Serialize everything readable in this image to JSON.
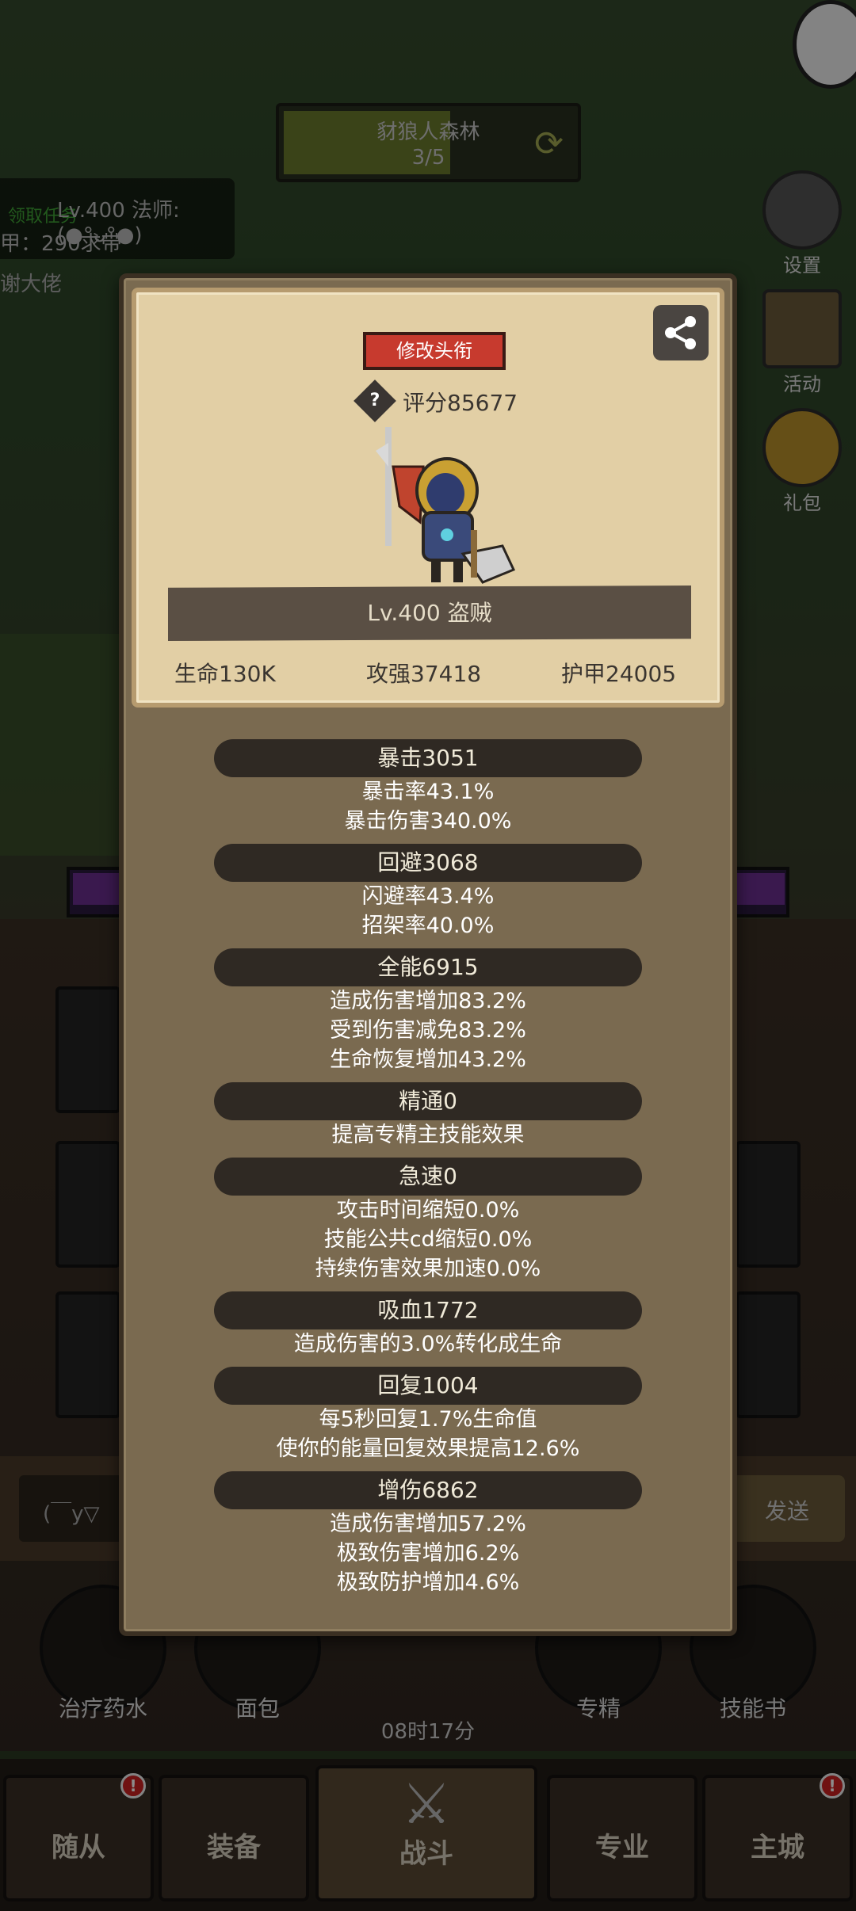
{
  "stage": {
    "title": "豺狼人森林",
    "count": "3/5"
  },
  "player": {
    "quest": "领取任务",
    "level_line": "Lv.400 法师: (●°ᴗ°●)",
    "armor_line": "甲：290求带",
    "thanks": "谢大佬"
  },
  "side_buttons": [
    {
      "label": "设置"
    },
    {
      "label": "活动"
    },
    {
      "label": "礼包"
    }
  ],
  "chat": {
    "placeholder": "(￣y▽",
    "send": "发送"
  },
  "items": [
    {
      "label": "治疗药水"
    },
    {
      "label": "面包"
    },
    {
      "label": "专精"
    },
    {
      "label": "技能书"
    }
  ],
  "timer": "08时17分",
  "nav": {
    "tabs": [
      {
        "label": "随从",
        "badge": "!"
      },
      {
        "label": "装备",
        "badge": ""
      },
      {
        "label": "战斗",
        "badge": ""
      },
      {
        "label": "专业",
        "badge": ""
      },
      {
        "label": "主城",
        "badge": "!"
      }
    ]
  },
  "modal": {
    "edit_title_button": "修改头衔",
    "help": "?",
    "score": "评分85677",
    "class_line": "Lv.400 盗贼",
    "core": {
      "hp": "生命130K",
      "attack": "攻强37418",
      "armor": "护甲24005"
    },
    "stats": [
      {
        "header": "暴击3051",
        "lines": [
          "暴击率43.1%",
          "暴击伤害340.0%"
        ]
      },
      {
        "header": "回避3068",
        "lines": [
          "闪避率43.4%",
          "招架率40.0%"
        ]
      },
      {
        "header": "全能6915",
        "lines": [
          "造成伤害增加83.2%",
          "受到伤害减免83.2%",
          "生命恢复增加43.2%"
        ]
      },
      {
        "header": "精通0",
        "lines": [
          "提高专精主技能效果"
        ]
      },
      {
        "header": "急速0",
        "lines": [
          "攻击时间缩短0.0%",
          "技能公共cd缩短0.0%",
          "持续伤害效果加速0.0%"
        ]
      },
      {
        "header": "吸血1772",
        "lines": [
          "造成伤害的3.0%转化成生命"
        ]
      },
      {
        "header": "回复1004",
        "lines": [
          "每5秒回复1.7%生命值",
          "使你的能量回复效果提高12.6%"
        ]
      },
      {
        "header": "增伤6862",
        "lines": [
          "造成伤害增加57.2%",
          "极致伤害增加6.2%",
          "极致防护增加4.6%"
        ]
      }
    ]
  },
  "colors": {
    "title_button": "#c73a2e",
    "card_bg": "#e2cfa5",
    "modal_bg": "#7a6a50",
    "stat_header_bg": "#2f2923"
  }
}
